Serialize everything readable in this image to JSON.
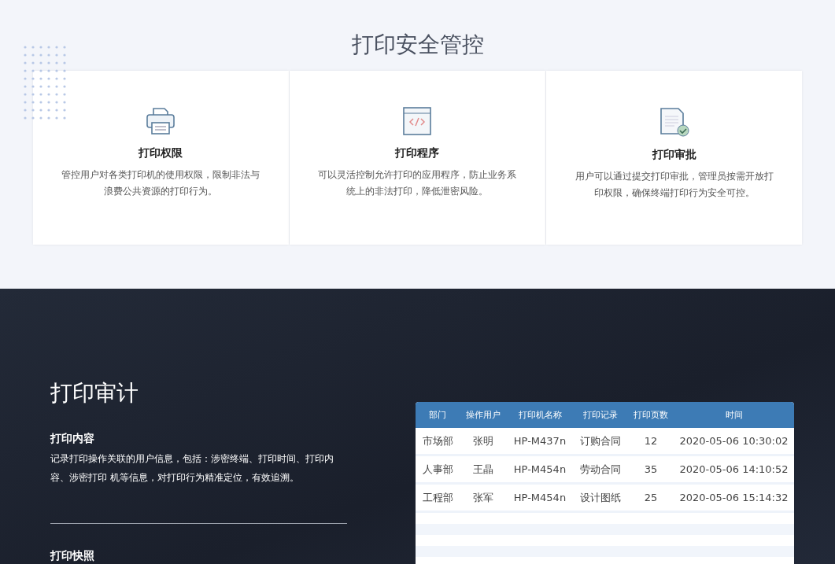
{
  "security": {
    "title": "打印安全管控",
    "cards": [
      {
        "kind": "printer",
        "title": "打印权限",
        "text": "管控用户对各类打印机的使用权限，限制非法与浪费公共资源的打印行为。"
      },
      {
        "kind": "code",
        "title": "打印程序",
        "text": "可以灵活控制允许打印的应用程序，防止业务系统上的非法打印，降低泄密风险。"
      },
      {
        "kind": "approval",
        "title": "打印审批",
        "text": "用户可以通过提交打印审批，管理员按需开放打印权限，确保终端打印行为安全可控。"
      }
    ]
  },
  "audit": {
    "title": "打印审计",
    "sections": [
      {
        "title": "打印内容",
        "text": "记录打印操作关联的用户信息，包括：涉密终端、打印时间、打印内容、涉密打印 机等信息，对打印行为精准定位，有效追溯。"
      },
      {
        "title": "打印快照"
      }
    ],
    "table": {
      "columns": [
        "部门",
        "操作用户",
        "打印机名称",
        "打印记录",
        "打印页数",
        "时间"
      ],
      "rows": [
        [
          "市场部",
          "张明",
          "HP-M437n",
          "订购合同",
          "12",
          "2020-05-06 10:30:02"
        ],
        [
          "人事部",
          "王晶",
          "HP-M454n",
          "劳动合同",
          "35",
          "2020-05-06 14:10:52"
        ],
        [
          "工程部",
          "张军",
          "HP-M454n",
          "设计图纸",
          "25",
          "2020-05-06 15:14:32"
        ]
      ]
    }
  }
}
